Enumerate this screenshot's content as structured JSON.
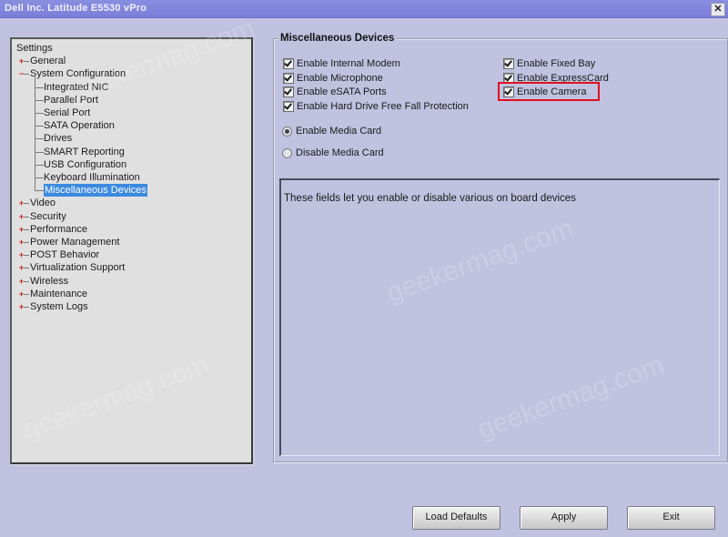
{
  "window": {
    "title": "Dell Inc. Latitude E5530 vPro",
    "close_icon": "close-icon"
  },
  "tree": {
    "root": "Settings",
    "items": [
      {
        "label": "General",
        "level": 1,
        "expander": "+"
      },
      {
        "label": "System Configuration",
        "level": 1,
        "expander": "-"
      },
      {
        "label": "Integrated NIC",
        "level": 2
      },
      {
        "label": "Parallel Port",
        "level": 2
      },
      {
        "label": "Serial Port",
        "level": 2
      },
      {
        "label": "SATA Operation",
        "level": 2
      },
      {
        "label": "Drives",
        "level": 2
      },
      {
        "label": "SMART Reporting",
        "level": 2
      },
      {
        "label": "USB Configuration",
        "level": 2
      },
      {
        "label": "Keyboard Illumination",
        "level": 2
      },
      {
        "label": "Miscellaneous Devices",
        "level": 2,
        "selected": true
      },
      {
        "label": "Video",
        "level": 1,
        "expander": "+"
      },
      {
        "label": "Security",
        "level": 1,
        "expander": "+"
      },
      {
        "label": "Performance",
        "level": 1,
        "expander": "+"
      },
      {
        "label": "Power Management",
        "level": 1,
        "expander": "+"
      },
      {
        "label": "POST Behavior",
        "level": 1,
        "expander": "+"
      },
      {
        "label": "Virtualization Support",
        "level": 1,
        "expander": "+"
      },
      {
        "label": "Wireless",
        "level": 1,
        "expander": "+"
      },
      {
        "label": "Maintenance",
        "level": 1,
        "expander": "+"
      },
      {
        "label": "System Logs",
        "level": 1,
        "expander": "+"
      }
    ]
  },
  "panel": {
    "title": "Miscellaneous Devices",
    "checkboxes_left": [
      {
        "label": "Enable Internal Modem",
        "checked": true
      },
      {
        "label": "Enable Microphone",
        "checked": true
      },
      {
        "label": "Enable eSATA Ports",
        "checked": true
      },
      {
        "label": "Enable Hard Drive Free Fall Protection",
        "checked": true
      }
    ],
    "checkboxes_right": [
      {
        "label": "Enable Fixed Bay",
        "checked": true
      },
      {
        "label": "Enable ExpressCard",
        "checked": true
      },
      {
        "label": "Enable Camera",
        "checked": true,
        "highlighted": true
      }
    ],
    "radios": [
      {
        "label": "Enable Media Card",
        "selected": true
      },
      {
        "label": "Disable Media Card",
        "selected": false
      }
    ],
    "description": "These fields let you enable or disable various on board devices",
    "highlight_color": "#e01020"
  },
  "buttons": {
    "load_defaults": "Load Defaults",
    "apply": "Apply",
    "exit": "Exit"
  },
  "watermark": "geekermag.com"
}
